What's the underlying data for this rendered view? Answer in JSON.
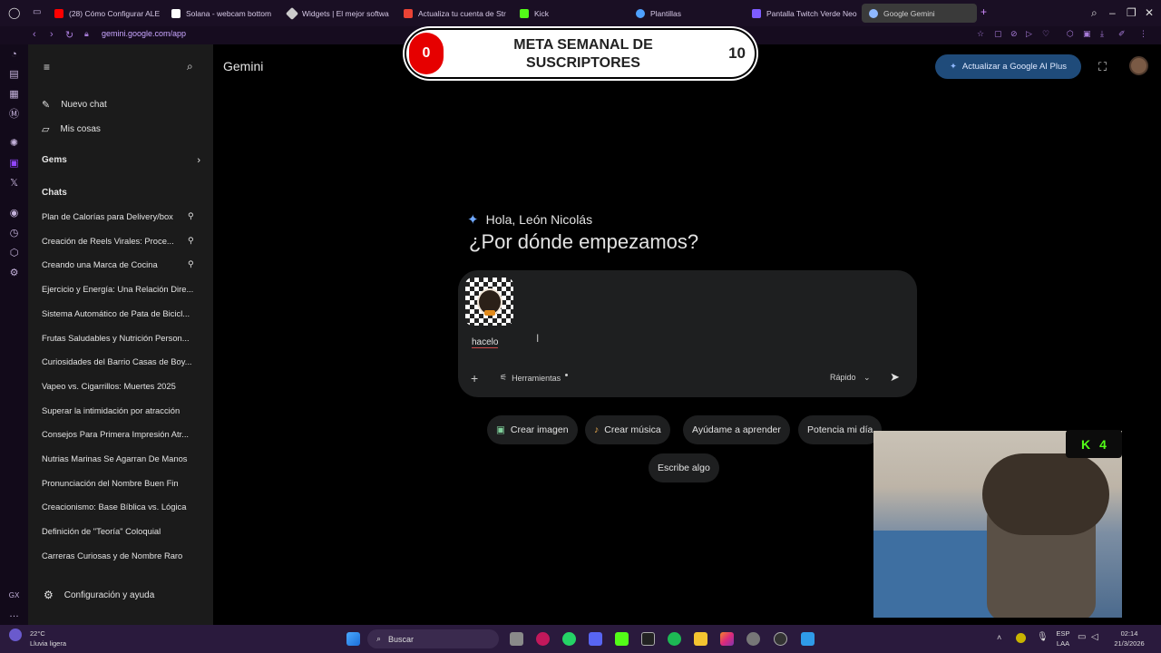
{
  "browser": {
    "tabs": [
      {
        "label": "(28) Cómo Configurar ALE",
        "color": "#ff0000"
      },
      {
        "label": "Solana - webcam bottom",
        "color": "#ffffff"
      },
      {
        "label": "Widgets | El mejor softwa",
        "color": "#dddddd"
      },
      {
        "label": "Actualiza tu cuenta de Str",
        "color": "#ea4335"
      },
      {
        "label": "Kick",
        "color": "#53fc18"
      },
      {
        "label": "Plantillas",
        "color": "#4ea1ff"
      },
      {
        "label": "Pantalla Twitch Verde Neo",
        "color": "#7d5cff"
      },
      {
        "label": "Google Gemini",
        "color": "#8fb8ff"
      }
    ],
    "url": "gemini.google.com/app"
  },
  "sidebar": {
    "new_chat": "Nuevo chat",
    "my_stuff": "Mis cosas",
    "gems": "Gems",
    "chats_heading": "Chats",
    "chats": [
      {
        "label": "Plan de Calorías para Delivery/box",
        "pinned": true
      },
      {
        "label": "Creación de Reels Virales: Proce...",
        "pinned": true
      },
      {
        "label": "Creando una Marca de Cocina",
        "pinned": true
      },
      {
        "label": "Ejercicio y Energía: Una Relación Dire...",
        "pinned": false
      },
      {
        "label": "Sistema Automático de Pata de Bicicl...",
        "pinned": false
      },
      {
        "label": "Frutas Saludables y Nutrición Person...",
        "pinned": false
      },
      {
        "label": "Curiosidades del Barrio Casas de Boy...",
        "pinned": false
      },
      {
        "label": "Vapeo vs. Cigarrillos: Muertes 2025",
        "pinned": false
      },
      {
        "label": "Superar la intimidación por atracción",
        "pinned": false
      },
      {
        "label": "Consejos Para Primera Impresión Atr...",
        "pinned": false
      },
      {
        "label": "Nutrias Marinas Se Agarran De Manos",
        "pinned": false
      },
      {
        "label": "Pronunciación del Nombre Buen Fin",
        "pinned": false
      },
      {
        "label": "Creacionismo: Base Bíblica vs. Lógica",
        "pinned": false
      },
      {
        "label": "Definición de \"Teoría\" Coloquial",
        "pinned": false
      },
      {
        "label": "Carreras Curiosas y de Nombre Raro",
        "pinned": false
      }
    ],
    "settings": "Configuración y ayuda"
  },
  "header": {
    "title": "Gemini",
    "upgrade": "Actualizar a Google AI Plus"
  },
  "overlay": {
    "goal_current": "0",
    "goal_title": "META SEMANAL DE SUSCRIPTORES",
    "goal_target": "10",
    "kick_count": "4"
  },
  "main": {
    "greeting": "Hola, León Nicolás",
    "question": "¿Por dónde empezamos?",
    "input_text": "hacelo",
    "tools": "Herramientas",
    "model": "Rápido",
    "chips": [
      "Crear imagen",
      "Crear música",
      "Ayúdame a aprender",
      "Potencia mi día",
      "Escribe algo"
    ]
  },
  "taskbar": {
    "weather_temp": "22°C",
    "weather_desc": "Lluvia ligera",
    "search": "Buscar",
    "lang_top": "ESP",
    "lang_bottom": "LAA",
    "time": "02:14",
    "date": "21/3/2026"
  },
  "colors": {
    "accent": "#1f4b7a",
    "goal_red": "#e60000",
    "kick_green": "#53fc18"
  }
}
